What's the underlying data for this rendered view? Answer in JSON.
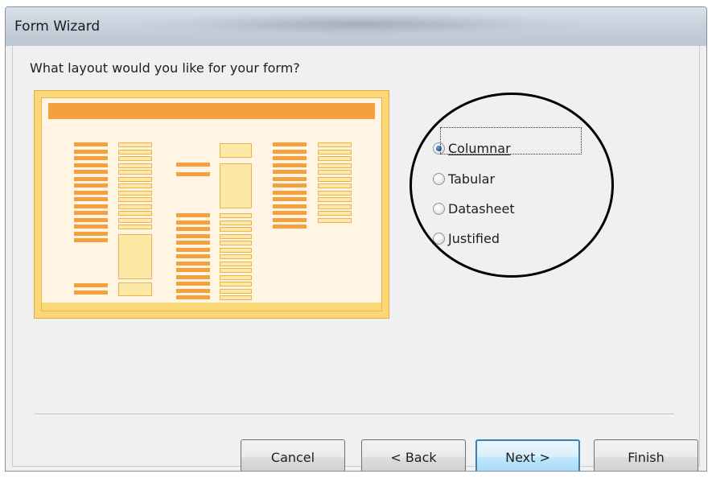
{
  "window": {
    "title": "Form Wizard"
  },
  "question": "What layout would you like for your form?",
  "layout_options": [
    {
      "label": "Columnar",
      "selected": true
    },
    {
      "label": "Tabular",
      "selected": false
    },
    {
      "label": "Datasheet",
      "selected": false
    },
    {
      "label": "Justified",
      "selected": false
    }
  ],
  "buttons": {
    "cancel": "Cancel",
    "back": "< Back",
    "next": "Next >",
    "finish": "Finish"
  },
  "colors": {
    "preview_accent": "#f3a13e",
    "preview_field": "#fde8a6",
    "default_button_border": "#3c7fb1",
    "annotation_circle": "#000000"
  }
}
